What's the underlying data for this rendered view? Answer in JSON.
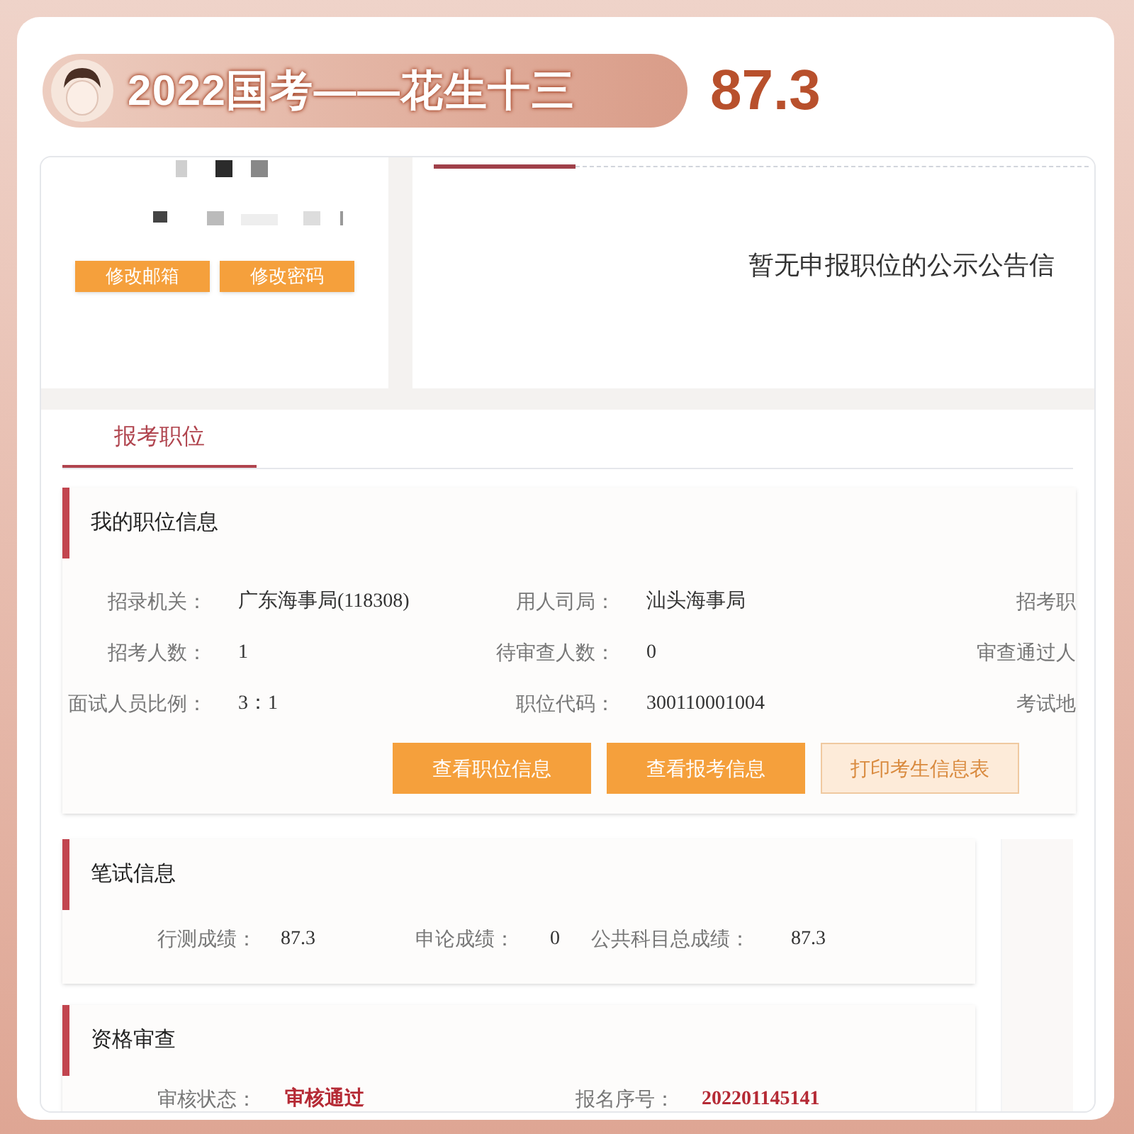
{
  "header": {
    "title": "2022国考——花生十三",
    "score": "87.3"
  },
  "account": {
    "buttons": [
      "修改邮箱",
      "修改密码"
    ]
  },
  "notice": {
    "message": "暂无申报职位的公示公告信"
  },
  "tabs": [
    {
      "label": "报考职位",
      "selected": true
    }
  ],
  "position_info": {
    "title": "我的职位信息",
    "rows": [
      [
        {
          "label": "招录机关：",
          "value": "广东海事局(118308)"
        },
        {
          "label": "用人司局：",
          "value": "汕头海事局"
        },
        {
          "label": "招考职"
        }
      ],
      [
        {
          "label": "招考人数：",
          "value": "1"
        },
        {
          "label": "待审查人数：",
          "value": "0"
        },
        {
          "label": "审查通过人"
        }
      ],
      [
        {
          "label": "面试人员比例：",
          "value": "3：1"
        },
        {
          "label": "职位代码：",
          "value": "300110001004"
        },
        {
          "label": "考试地"
        }
      ]
    ],
    "buttons": [
      {
        "label": "查看职位信息",
        "kind": "primary"
      },
      {
        "label": "查看报考信息",
        "kind": "primary"
      },
      {
        "label": "打印考生信息表",
        "kind": "secondary"
      }
    ]
  },
  "written_exam": {
    "title": "笔试信息",
    "fields": [
      {
        "label": "行测成绩：",
        "value": "87.3",
        "emphasis": false
      },
      {
        "label": "申论成绩：",
        "value": "0",
        "emphasis": false
      },
      {
        "label": "公共科目总成绩：",
        "value": "87.3",
        "emphasis": false
      }
    ]
  },
  "qualification": {
    "title": "资格审查",
    "fields": [
      {
        "label": "审核状态：",
        "value": "审核通过",
        "emphasis": true
      },
      {
        "label": "报名序号：",
        "value": "202201145141",
        "emphasis": true
      }
    ]
  }
}
